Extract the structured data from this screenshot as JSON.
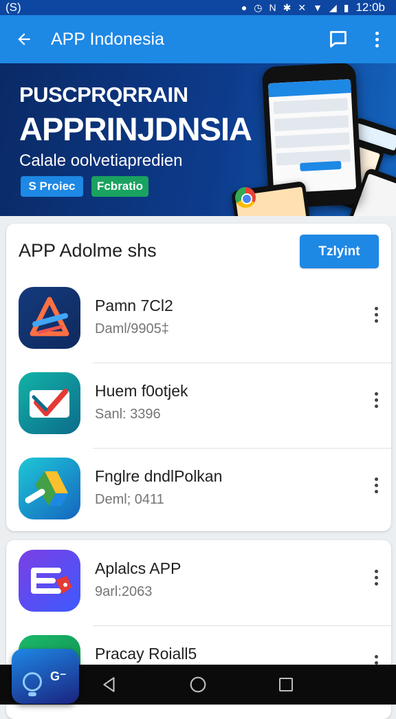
{
  "status_bar": {
    "left_text": "(S)",
    "time": "12:0b",
    "icons": [
      "location-icon",
      "alarm-icon",
      "nfc-icon",
      "bluetooth-icon",
      "vibrate-icon",
      "wifi-icon",
      "signal-icon",
      "battery-icon"
    ]
  },
  "app_bar": {
    "title": "APP Indonesia",
    "icons": [
      "back-arrow-icon",
      "message-icon",
      "more-vert-icon"
    ]
  },
  "banner": {
    "eyebrow": "PUSCРRQRRAIN",
    "headline": "APPRINJDNSIA",
    "subtitle": "Calale oolvetiapredien",
    "chip_blue": "S Proiec",
    "chip_green": "Fcbratio"
  },
  "card1": {
    "title": "APP Adolme shs",
    "button": "Tzlyint",
    "items": [
      {
        "title": "Pamn 7Cl2",
        "subtitle": "Daml/9905‡",
        "icon": "tools-app-icon"
      },
      {
        "title": "Huem f0otjek",
        "subtitle": "Sanl: 3396",
        "icon": "check-app-icon"
      },
      {
        "title": "Fnglre dndlPolkan",
        "subtitle": "Deml; 0411",
        "icon": "drive-app-icon"
      }
    ]
  },
  "card2": {
    "items": [
      {
        "title": "Aplalcs APP",
        "subtitle": "9arl:2063",
        "icon": "tag-app-icon"
      },
      {
        "title": "Pracay Roiall5",
        "subtitle": "",
        "icon": "letter-a-app-icon"
      }
    ]
  },
  "fab": {
    "label": "G⁻",
    "icon": "assistant-icon"
  },
  "nav": {
    "icons": [
      "nav-back-icon",
      "nav-home-icon",
      "nav-recents-icon"
    ]
  },
  "colors": {
    "primary": "#1e88e5",
    "status_bar": "#0d47a1",
    "banner": "#0d3b8c",
    "accent_green": "#1aa260"
  }
}
